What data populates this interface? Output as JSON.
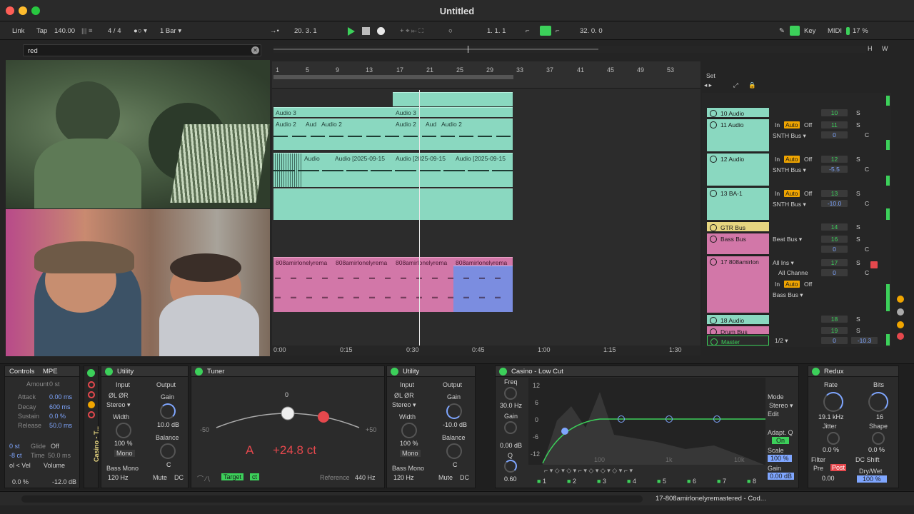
{
  "window": {
    "title": "Untitled"
  },
  "colors": {
    "accent": "#3cd05a",
    "clip_teal": "#8ad8c0",
    "clip_pink": "#d277a8",
    "clip_blue": "#7b8de0",
    "value_blue": "#7fa6ff",
    "record_red": "#e5484d"
  },
  "control_bar": {
    "link": "Link",
    "tap": "Tap",
    "tempo": "140.00",
    "meter": "4 / 4",
    "quantize": "1 Bar",
    "position": "20.  3.  1",
    "loop_start": "1.  1.  1",
    "loop_length": "32.  0.  0",
    "key": "Key",
    "midi": "MIDI",
    "cpu": "17 %"
  },
  "search": {
    "value": "red"
  },
  "ruler": {
    "bars": [
      "1",
      "5",
      "9",
      "13",
      "17",
      "21",
      "25",
      "29",
      "33",
      "37",
      "41",
      "45",
      "49",
      "53"
    ],
    "times": [
      "0:00",
      "0:15",
      "0:30",
      "0:45",
      "1:00",
      "1:15",
      "1:30"
    ]
  },
  "clips": {
    "audio3": [
      "Audio 3",
      "Audio 3"
    ],
    "audio2": [
      "Audio 2",
      "Aud",
      "Audio 2",
      "Audio 2",
      "Aud",
      "Audio 2"
    ],
    "audio_rec": [
      "Audio",
      "Audio [2025-09-15",
      "Audio [2025-09-15",
      "Audio [2025-09-15"
    ],
    "pink": [
      "808amirlonelyrema",
      "808amirlonelyrema",
      "808amirlonelyrema",
      "808amirlonelyrema"
    ]
  },
  "mixer": {
    "set": "Set",
    "tracks": [
      {
        "name": "10 Audio",
        "num": "10",
        "solo": "S"
      },
      {
        "name": "11 Audio",
        "num": "11",
        "solo": "S",
        "vol": "0",
        "route": "SNTH Bus",
        "pan": "C"
      },
      {
        "name": "12 Audio",
        "num": "12",
        "solo": "S",
        "vol": "-5.5",
        "route": "SNTH Bus",
        "pan": "C"
      },
      {
        "name": "13 BA-1",
        "num": "13",
        "solo": "S",
        "vol": "-10.0",
        "route": "SNTH Bus",
        "pan": "C"
      },
      {
        "name": "GTR Bus",
        "num": "14",
        "solo": "S"
      },
      {
        "name": "Bass Bus",
        "num": "16",
        "solo": "S",
        "vol": "0",
        "route": "Beat Bus",
        "pan": "C"
      },
      {
        "name": "17 808amirlon",
        "num": "17",
        "solo": "S",
        "vol": "0",
        "input": "All Ins",
        "channel": "All Channe",
        "route": "Bass Bus",
        "pan": "C"
      },
      {
        "name": "18 Audio",
        "num": "18",
        "solo": "S"
      },
      {
        "name": "Drum Bus",
        "num": "19",
        "solo": "S"
      },
      {
        "name": "Master",
        "num": "0",
        "vol": "-10.3",
        "ratio": "1/2"
      }
    ],
    "io": {
      "in": "In",
      "auto": "Auto",
      "off": "Off"
    }
  },
  "devices": {
    "controls": {
      "title": "Controls",
      "mpe": "MPE",
      "amount": "Amount",
      "amount_val": "0 st",
      "attack": "Attack",
      "attack_val": "0.00 ms",
      "decay": "Decay",
      "decay_val": "600 ms",
      "sustain": "Sustain",
      "sustain_val": "0.0 %",
      "release": "Release",
      "release_val": "50.0 ms",
      "st": "0 st",
      "glide": "Glide",
      "glide_val": "Off",
      "ct": "-8 ct",
      "time": "Time",
      "time_val": "50.0 ms",
      "vel": "ol < Vel",
      "volume": "Volume",
      "vel_val": "0.0 %",
      "vol_val": "-12.0 dB",
      "rack": "Casino - T..."
    },
    "utility1": {
      "title": "Utility",
      "input": "Input",
      "output": "Output",
      "ch": "ØL  ØR",
      "mode": "Stereo",
      "gain": "Gain",
      "gain_val": "10.0 dB",
      "width": "Width",
      "width_val": "100 %",
      "mono": "Mono",
      "balance": "Balance",
      "bal_val": "C",
      "bass_mono": "Bass Mono",
      "freq": "120 Hz",
      "mute": "Mute",
      "dc": "DC"
    },
    "tuner": {
      "title": "Tuner",
      "zero": "0",
      "minus": "-50",
      "plus": "+50",
      "note": "A",
      "cents": "+24.8 ct",
      "target": "Target",
      "ct": "ct",
      "reference": "Reference",
      "ref_val": "440 Hz"
    },
    "utility2": {
      "title": "Utility",
      "input": "Input",
      "output": "Output",
      "ch": "ØL  ØR",
      "mode": "Stereo",
      "gain": "Gain",
      "gain_val": "-10.0 dB",
      "width": "Width",
      "width_val": "100 %",
      "mono": "Mono",
      "balance": "Balance",
      "bal_val": "C",
      "bass_mono": "Bass Mono",
      "freq": "120 Hz",
      "mute": "Mute",
      "dc": "DC"
    },
    "eq": {
      "title": "Casino - Low Cut",
      "freq": "Freq",
      "freq_val": "30.0 Hz",
      "gain": "Gain",
      "gain_val": "0.00 dB",
      "q": "Q",
      "q_val": "0.60",
      "db_labels": [
        "12",
        "6",
        "0",
        "-6",
        "-12"
      ],
      "hz_labels": [
        "100",
        "1k",
        "10k"
      ],
      "bands": [
        "1",
        "2",
        "3",
        "4",
        "5",
        "6",
        "7",
        "8"
      ],
      "mode": "Mode",
      "mode_val": "Stereo",
      "edit": "Edit",
      "adapt": "Adapt. Q",
      "on": "On",
      "scale": "Scale",
      "scale_val": "100 %",
      "gain2": "Gain",
      "gain2_val": "0.00 dB"
    },
    "redux": {
      "title": "Redux",
      "rate": "Rate",
      "rate_val": "19.1 kHz",
      "bits": "Bits",
      "bits_val": "16",
      "jitter": "Jitter",
      "jitter_val": "0.0 %",
      "shape": "Shape",
      "shape_val": "0.0 %",
      "filter": "Filter",
      "pre": "Pre",
      "post": "Post",
      "dc_shift": "DC Shift",
      "filter_val": "0.00",
      "drywet": "Dry/Wet",
      "drywet_val": "100 %"
    }
  },
  "status": {
    "text": "17-808amirlonelyremastered - Cod..."
  }
}
